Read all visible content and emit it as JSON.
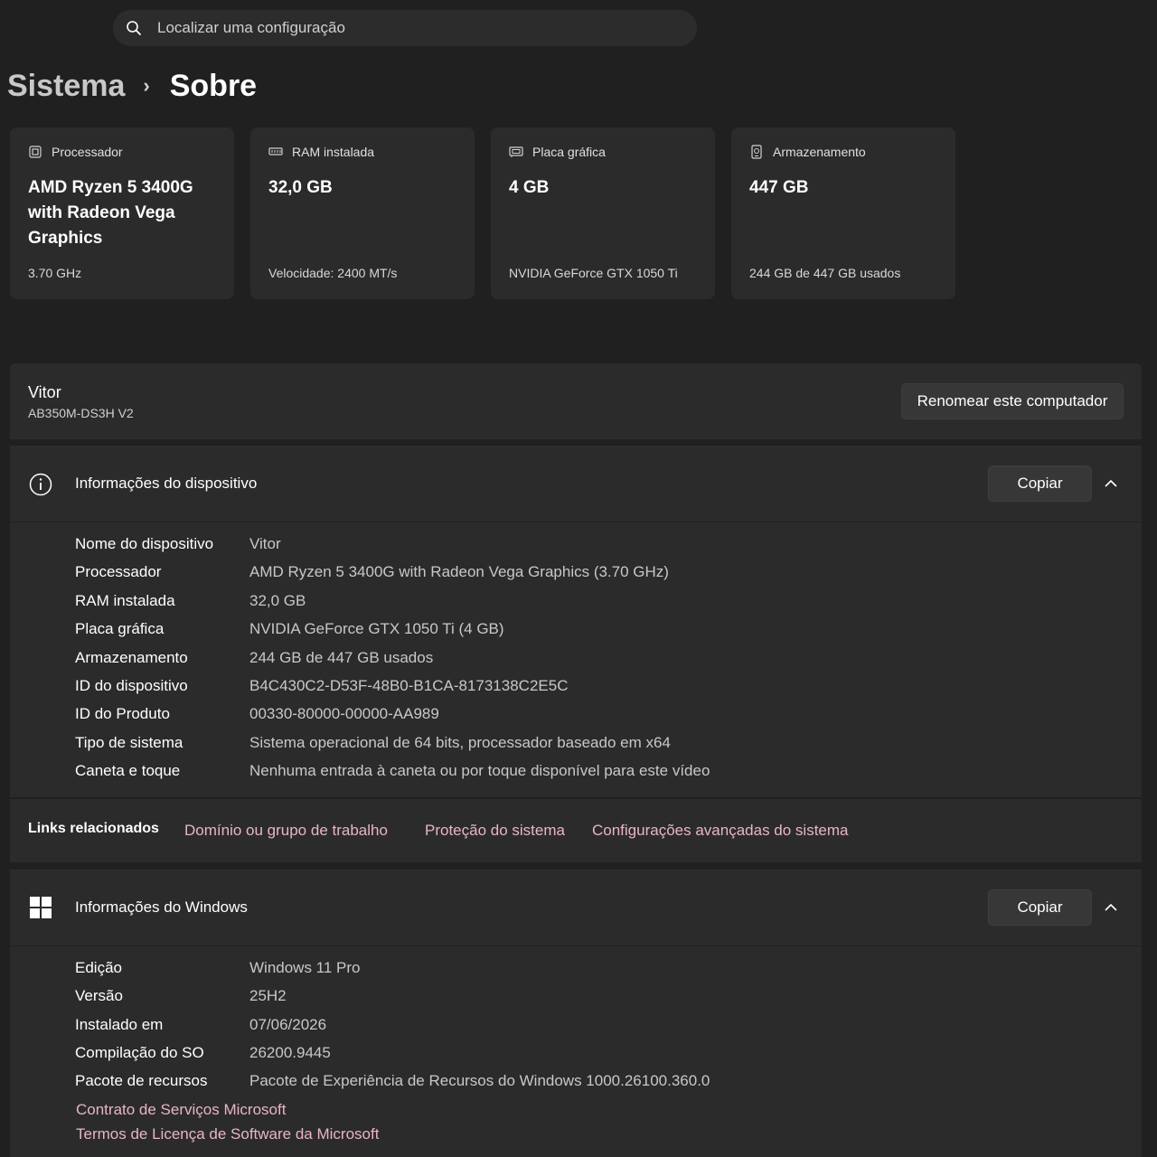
{
  "search": {
    "placeholder": "Localizar uma configuração",
    "icon": "search-icon"
  },
  "breadcrumb": {
    "parent": "Sistema",
    "separator": "›",
    "current": "Sobre"
  },
  "specs": [
    {
      "icon": "processor-icon",
      "label": "Processador",
      "value": "AMD Ryzen 5 3400G with Radeon Vega Graphics",
      "sub": "3.70 GHz"
    },
    {
      "icon": "ram-icon",
      "label": "RAM instalada",
      "value": "32,0 GB",
      "sub": "Velocidade: 2400 MT/s"
    },
    {
      "icon": "gpu-icon",
      "label": "Placa gráfica",
      "value": "4 GB",
      "sub": "NVIDIA GeForce GTX 1050 Ti"
    },
    {
      "icon": "storage-icon",
      "label": "Armazenamento",
      "value": "447 GB",
      "sub": "244 GB de 447 GB usados"
    }
  ],
  "computer": {
    "name": "Vitor",
    "model": "AB350M-DS3H V2",
    "rename_label": "Renomear este computador"
  },
  "device_info": {
    "title": "Informações do dispositivo",
    "copy_label": "Copiar",
    "rows": [
      {
        "key": "Nome do dispositivo",
        "value": "Vitor"
      },
      {
        "key": "Processador",
        "value": "AMD Ryzen 5 3400G with Radeon Vega Graphics (3.70 GHz)"
      },
      {
        "key": "RAM instalada",
        "value": "32,0 GB"
      },
      {
        "key": "Placa gráfica",
        "value": "NVIDIA GeForce GTX 1050 Ti (4 GB)"
      },
      {
        "key": "Armazenamento",
        "value": "244 GB de 447 GB usados"
      },
      {
        "key": "ID do dispositivo",
        "value": "B4C430C2-D53F-48B0-B1CA-8173138C2E5C"
      },
      {
        "key": "ID do Produto",
        "value": "00330-80000-00000-AA989"
      },
      {
        "key": "Tipo de sistema",
        "value": "Sistema operacional de 64 bits, processador baseado em x64"
      },
      {
        "key": "Caneta e toque",
        "value": "Nenhuma entrada à caneta ou por toque disponível para este vídeo"
      }
    ]
  },
  "related_links": {
    "label": "Links relacionados",
    "links": [
      "Domínio ou grupo de trabalho",
      "Proteção do sistema",
      "Configurações avançadas do sistema"
    ]
  },
  "windows_info": {
    "title": "Informações do Windows",
    "copy_label": "Copiar",
    "rows": [
      {
        "key": "Edição",
        "value": "Windows 11 Pro"
      },
      {
        "key": "Versão",
        "value": "25H2"
      },
      {
        "key": "Instalado em",
        "value": "07/06/2026"
      },
      {
        "key": "Compilação do SO",
        "value": "26200.9445"
      },
      {
        "key": "Pacote de recursos",
        "value": "Pacote de Experiência de Recursos do Windows 1000.26100.360.0"
      }
    ],
    "links": [
      "Contrato de Serviços Microsoft",
      "Termos de Licença de Software da Microsoft"
    ]
  },
  "colors": {
    "background": "#202020",
    "card": "#2b2b2b",
    "link": "#e8b4c8"
  }
}
